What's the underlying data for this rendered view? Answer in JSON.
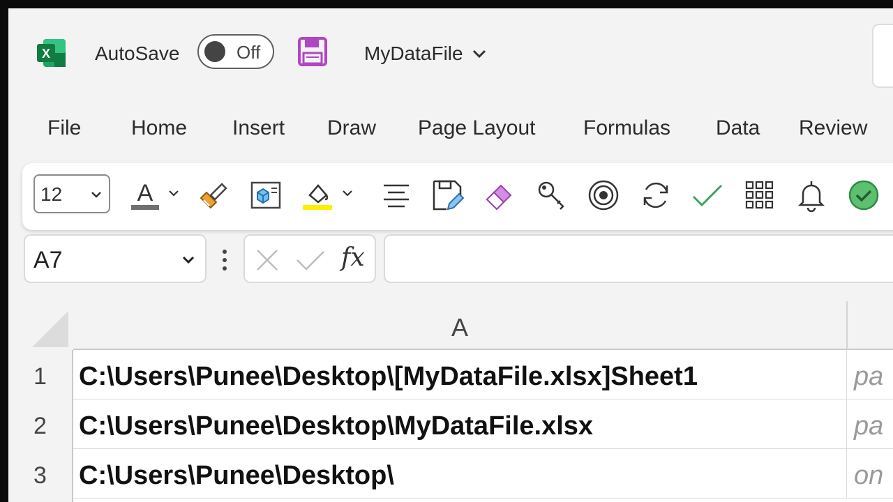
{
  "titlebar": {
    "autosave_label": "AutoSave",
    "autosave_state": "Off",
    "filename": "MyDataFile",
    "app_icon": "excel-logo-icon",
    "save_icon": "save-icon"
  },
  "menu": {
    "items": [
      "File",
      "Home",
      "Insert",
      "Draw",
      "Page Layout",
      "Formulas",
      "Data",
      "Review"
    ]
  },
  "ribbon": {
    "font_size": "12",
    "icons": [
      "font-color-icon",
      "format-painter-icon",
      "3d-model-icon",
      "fill-color-icon",
      "align-center-icon",
      "save-as-icon",
      "eraser-icon",
      "key-icon",
      "target-icon",
      "refresh-icon",
      "checkmark-icon",
      "grid-icon",
      "bell-icon",
      "approved-icon"
    ],
    "font_color_underline": "#6f6f6f",
    "fill_color_underline": "#ffee00"
  },
  "formula_bar": {
    "name_box": "A7",
    "fx_label": "fx",
    "formula": ""
  },
  "sheet": {
    "column_headers": [
      "A"
    ],
    "rows": [
      {
        "num": "1",
        "a": "C:\\Users\\Punee\\Desktop\\[MyDataFile.xlsx]Sheet1",
        "b": "pa"
      },
      {
        "num": "2",
        "a": "C:\\Users\\Punee\\Desktop\\MyDataFile.xlsx",
        "b": "pa"
      },
      {
        "num": "3",
        "a": "C:\\Users\\Punee\\Desktop\\",
        "b": "on"
      }
    ]
  },
  "colors": {
    "excel_green": "#107c41",
    "save_purple": "#b146c2",
    "accent_green": "#3ba55c"
  }
}
